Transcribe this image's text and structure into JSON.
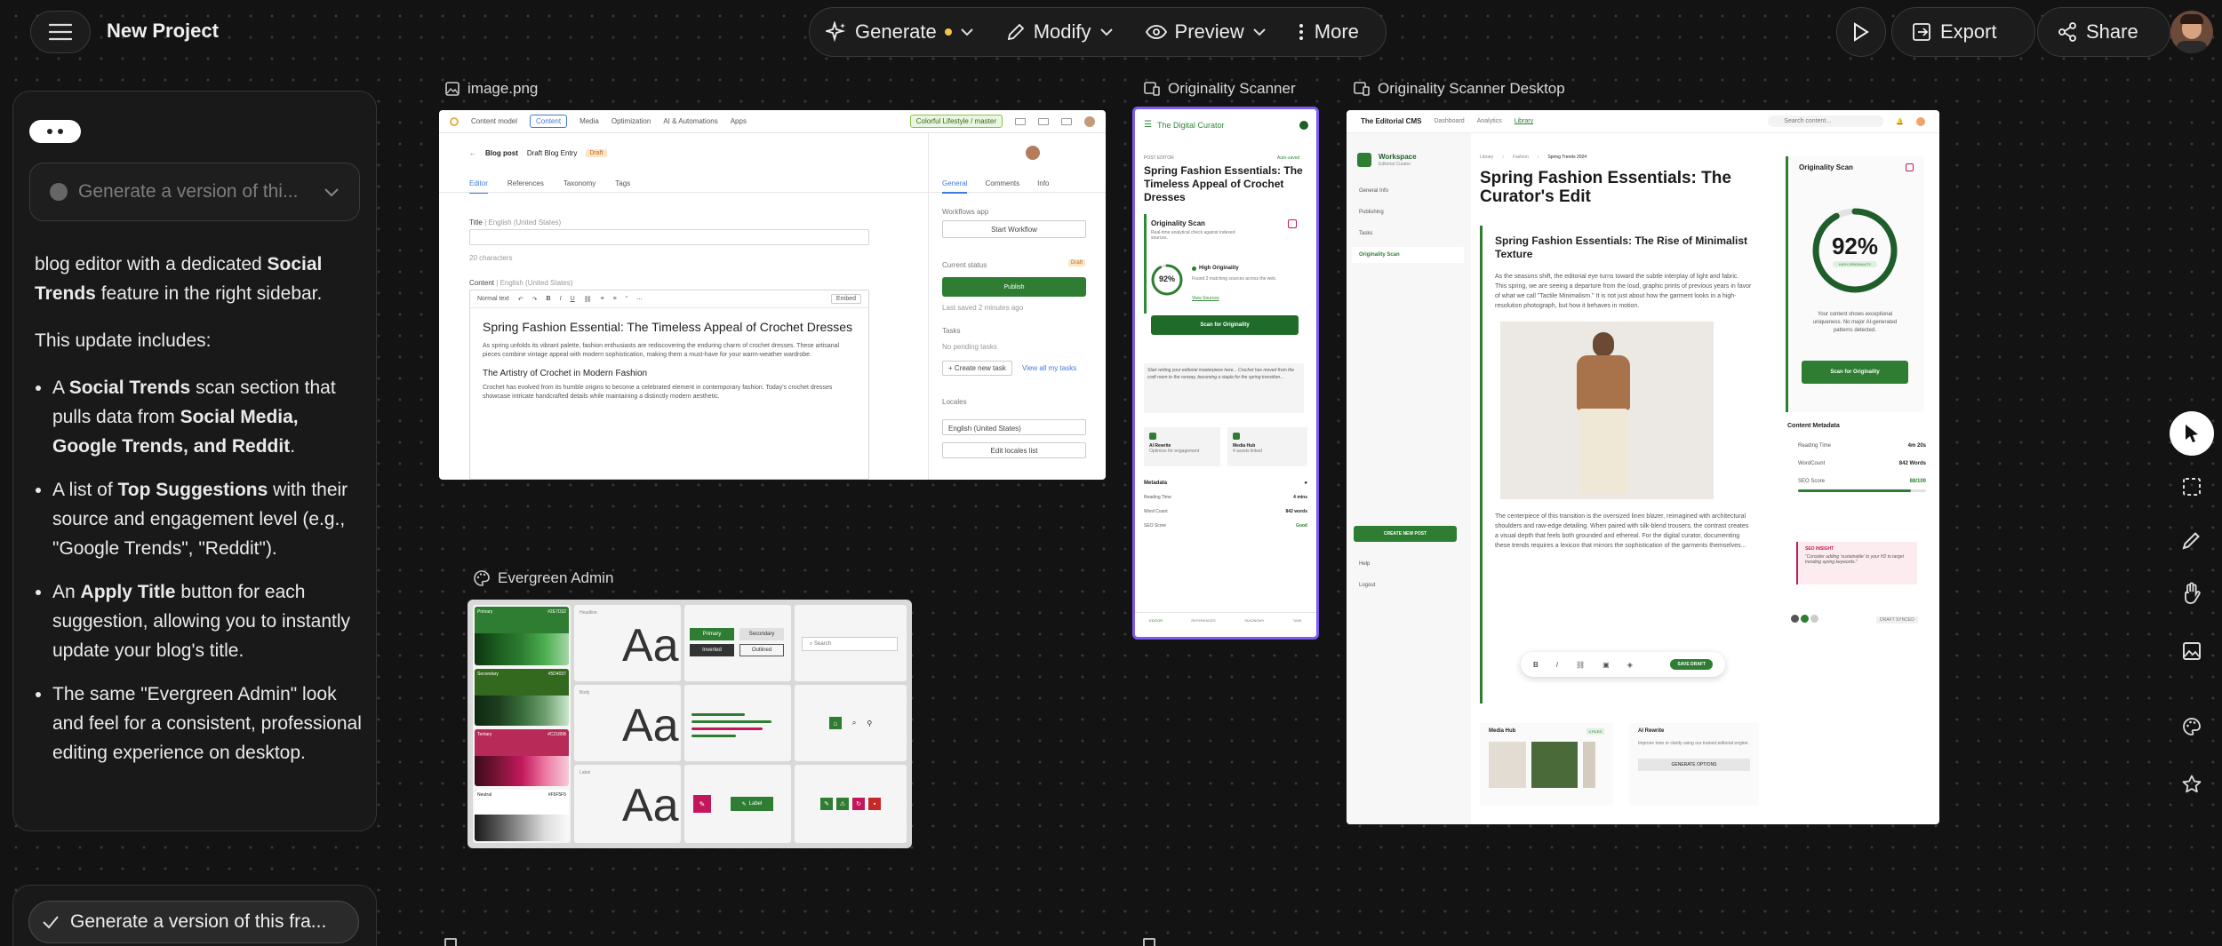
{
  "topbar": {
    "title": "New Project",
    "generate": "Generate",
    "modify": "Modify",
    "preview": "Preview",
    "more": "More",
    "export": "Export",
    "share": "Share"
  },
  "chat": {
    "input_placeholder": "Generate a version of thi...",
    "paragraph1_pre": "blog editor with a dedicated ",
    "paragraph1_bold": "Social Trends",
    "paragraph1_post": " feature in the right sidebar.",
    "paragraph2": "This update includes:",
    "b1_t1": "A ",
    "b1_b1": "Social Trends",
    "b1_t2": " scan section that pulls data from ",
    "b1_b2": "Social Media, Google Trends, and Reddit",
    "b1_t3": ".",
    "b2_t1": "A list of ",
    "b2_b1": "Top Suggestions",
    "b2_t2": " with their source and engagement level (e.g., \"Google Trends\", \"Reddit\").",
    "b3_t1": "An ",
    "b3_b1": "Apply Title",
    "b3_t2": " button for each suggestion, allowing you to instantly update your blog's title.",
    "b4": "The same \"Evergreen Admin\" look and feel for a consistent, professional editing experience on desktop.",
    "bottom_button": "Generate a version of this fra..."
  },
  "labels": {
    "image": "image.png",
    "scanner": "Originality Scanner",
    "scanner_desktop": "Originality Scanner Desktop",
    "evergreen": "Evergreen Admin"
  },
  "img": {
    "nav1": "Content model",
    "nav2": "Content",
    "nav3": "Media",
    "nav4": "Optimization",
    "nav5": "AI & Automations",
    "nav6": "Apps",
    "env": "Colorful Lifestyle / master",
    "crumb1": "Blog post",
    "crumb2": "Draft Blog Entry",
    "status": "Draft",
    "tab1": "Editor",
    "tab2": "References",
    "tab3": "Taxonomy",
    "tab4": "Tags",
    "rtab1": "General",
    "rtab2": "Comments",
    "rtab3": "Info",
    "title_label": "Title",
    "locale": "English (United States)",
    "chars": "20 characters",
    "content_label": "Content",
    "normal": "Normal text",
    "embed": "Embed",
    "h1": "Spring Fashion Essential: The Timeless Appeal of Crochet Dresses",
    "p1": "As spring unfolds its vibrant palette, fashion enthusiasts are rediscovering the enduring charm of crochet dresses. These artisanal pieces combine vintage appeal with modern sophistication, making them a must-have for your warm-weather wardrobe.",
    "h2": "The Artistry of Crochet in Modern Fashion",
    "p2": "Crochet has evolved from its humble origins to become a celebrated element in contemporary fashion. Today's crochet dresses showcase intricate handcrafted details while maintaining a distinctly modern aesthetic.",
    "workflows": "Workflows app",
    "start_workflow": "Start Workflow",
    "current_status": "Current status",
    "publish": "Publish",
    "saved": "Last saved 2 minutes ago",
    "tasks": "Tasks",
    "no_tasks": "No pending tasks",
    "create_task": "+ Create new task",
    "view_tasks": "View all my tasks",
    "locales": "Locales",
    "edit_locales": "Edit locales list"
  },
  "mob": {
    "brand": "The Digital Curator",
    "post_editor": "POST EDITOR",
    "autosaved": "Auto-saved",
    "title": "Spring Fashion Essentials: The Timeless Appeal of Crochet Dresses",
    "scan_title": "Originality Scan",
    "scan_desc": "Real-time analytical check against indexed sources.",
    "pct": "92%",
    "high": "High Originality",
    "found": "Found 3 matching sources across the web.",
    "view_sources": "View Sources",
    "scan_btn": "Scan for Originality",
    "draft_text": "Start writing your editorial masterpiece here... Crochet has moved from the craft room to the runway, becoming a staple for the spring transition...",
    "ai": "AI Rewrite",
    "ai_sub": "Optimize for engagement",
    "media": "Media Hub",
    "media_sub": "4 assets linked",
    "metadata": "Metadata",
    "m1": "Reading Time",
    "m1v": "4 mins",
    "m2": "Word Count",
    "m2v": "842 words",
    "m3": "SEO Score",
    "m3v": "Good",
    "nav1": "EDITOR",
    "nav2": "REFERENCES",
    "nav3": "TAXONOMY",
    "nav4": "TASK"
  },
  "desk": {
    "brand": "The Editorial CMS",
    "nav1": "Dashboard",
    "nav2": "Analytics",
    "nav3": "Library",
    "search": "Search content...",
    "ws": "Workspace",
    "ws_sub": "Editorial Curator",
    "s1": "General Info",
    "s2": "Publishing",
    "s3": "Tasks",
    "s4": "Originality Scan",
    "create": "CREATE NEW POST",
    "help": "Help",
    "logout": "Logout",
    "crumb1": "Library",
    "crumb2": "Fashion",
    "crumb3": "Spring Trends 2024",
    "title": "Spring Fashion Essentials: The Curator's Edit",
    "subtitle": "Spring Fashion Essentials: The Rise of Minimalist Texture",
    "p1": "As the seasons shift, the editorial eye turns toward the subtle interplay of light and fabric. This spring, we are seeing a departure from the loud, graphic prints of previous years in favor of what we call \"Tactile Minimalism.\" It is not just about how the garment looks in a high-resolution photograph, but how it behaves in motion.",
    "p2": "The centerpiece of this transition is the oversized linen blazer, reimagined with architectural shoulders and raw-edge detailing. When paired with silk-blend trousers, the contrast creates a visual depth that feels both grounded and ethereal. For the digital curator, documenting these trends requires a lexicon that mirrors the sophistication of the garments themselves...",
    "save_draft": "SAVE DRAFT",
    "scan_title": "Originality Scan",
    "pct": "92%",
    "high": "HIGH ORIGINALITY",
    "scan_desc": "Your content shows exceptional uniqueness. No major AI-generated patterns detected.",
    "scan_btn": "Scan for Originality",
    "meta": "Content Metadata",
    "r1": "Reading Time",
    "r1v": "4m 20s",
    "r2": "WordCount",
    "r2v": "842 Words",
    "r3": "SEO Score",
    "r3v": "88/100",
    "insight": "SEO INSIGHT",
    "insight_txt": "\"Consider adding 'sustainable' to your H2 to target trending spring keywords.\"",
    "draft_synced": "DRAFT SYNCED",
    "media": "Media Hub",
    "files": "4 FILES",
    "ai": "AI Rewrite",
    "ai_sub": "Improve tone or clarity using our trained editorial engine.",
    "gen": "GENERATE OPTIONS"
  },
  "eg": {
    "primary": "Primary",
    "primary_hex": "#2E7D32",
    "secondary": "Secondary",
    "secondary_hex": "#5D4037",
    "tertiary": "Tertiary",
    "tertiary_hex": "#C2185B",
    "neutral": "Neutral",
    "neutral_hex": "#F5F5F5",
    "headline": "Headline",
    "body": "Body",
    "label": "Label",
    "aa": "Aa",
    "btn_primary": "Primary",
    "btn_secondary": "Secondary",
    "btn_inverted": "Inverted",
    "btn_outlined": "Outlined",
    "search": "Search",
    "label_btn": "Label"
  },
  "scores": {
    "originality": 92,
    "seo": 88
  },
  "colors": {
    "primary": "#2e7d32",
    "secondary": "#5d4037",
    "tertiary": "#c2185b",
    "mobile_border": "#7c5cf0"
  }
}
